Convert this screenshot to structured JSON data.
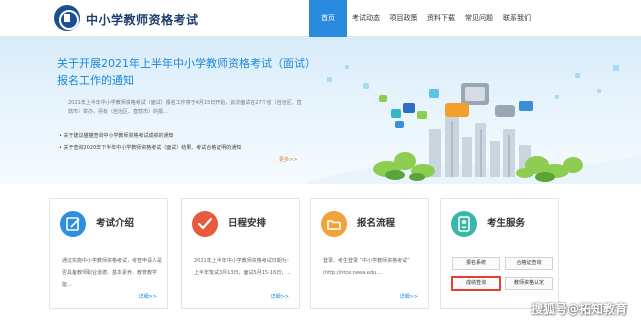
{
  "header": {
    "site_title": "中小学教师资格考试",
    "nav": [
      "首页",
      "考试动态",
      "项目政策",
      "资料下载",
      "常见问题",
      "联系我们"
    ],
    "active_nav": "首页"
  },
  "banner": {
    "title": "关于开展2021年上半年中小学教师资格考试（面试）报名工作的通知",
    "desc": "2021年上半年中小学教师资格考试（面试）报名工作将于4月15日开始，此次面试在27个省（自治区、直辖市）举办，另有（自治区、直辖市）的报...",
    "links": [
      "关于建议猫猫查询中小学教师资格考试成绩的通知",
      "关于查询2020年下半年中小学教师资格考试（面试）结果、考试合格证明的通知"
    ],
    "more": "更多>>"
  },
  "cards": [
    {
      "title": "考试介绍",
      "icon": "edit-icon",
      "desc": "通过实施中小学教师资格考试，考查申请人是否具备教师职业道德、基本素养、教育教学能...",
      "more": "详细>>"
    },
    {
      "title": "日程安排",
      "icon": "checkmark-icon",
      "desc": "2021年上半年中小学教师资格考试日期为：上半年笔试3月13日，面试5月15-16日；...",
      "more": "详细>>"
    },
    {
      "title": "报名流程",
      "icon": "folder-icon",
      "desc": "登录、考生登录 “中小学教师资格考试” (http://ntce.neea.edu....",
      "more": "详细>>"
    },
    {
      "title": "考生服务",
      "icon": "user-icon",
      "buttons": [
        "报名系统",
        "合格证查询",
        "成绩查询",
        "教师资格认定"
      ],
      "highlighted": "成绩查询"
    }
  ],
  "watermark": "搜狐号@拓知教育",
  "colors": {
    "accent": "#2a8ae0",
    "title_blue": "#1a87d9",
    "highlight": "#e8402e",
    "icon_blue": "#2c8fe0",
    "icon_red": "#e85a3c",
    "icon_orange": "#f3a13a",
    "icon_teal": "#3cb6a8"
  }
}
